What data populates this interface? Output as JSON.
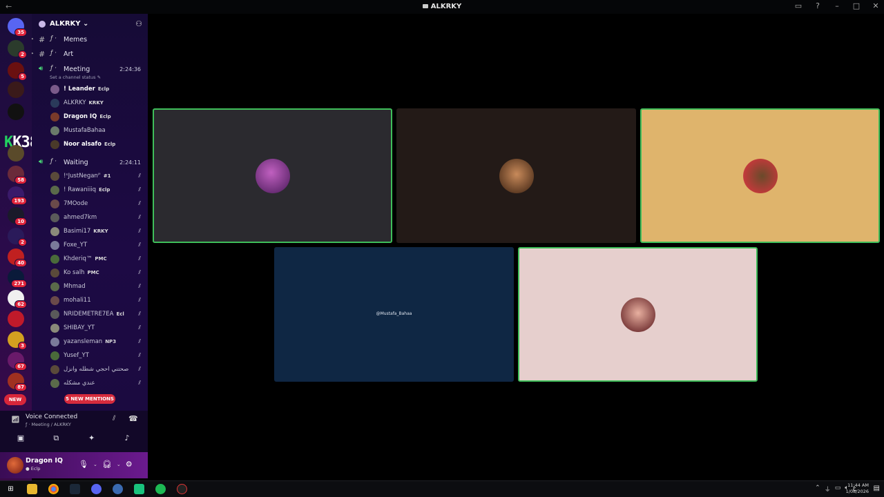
{
  "window": {
    "title": "ALKRKY"
  },
  "server_badges": [
    "35",
    "2",
    "5",
    "58",
    "193",
    "10",
    "2",
    "40",
    "271",
    "62",
    "3",
    "67",
    "87",
    "2"
  ],
  "server_new_label": "NEW",
  "promo_text": "K38",
  "guild": {
    "name": "ALKRKY"
  },
  "channels": {
    "memes": "Memes",
    "art": "Art",
    "meeting": {
      "name": "Meeting",
      "time": "2:24:36",
      "status": "Set a channel status"
    },
    "waiting": {
      "name": "Waiting",
      "time": "2:24:11"
    }
  },
  "meeting_members": [
    {
      "name": "! Leander",
      "tag": "Eclp",
      "bold": true
    },
    {
      "name": "ALKRKY",
      "tag": "KRKY",
      "bold": false
    },
    {
      "name": "Dragon IQ",
      "tag": "Eclp",
      "bold": true
    },
    {
      "name": "MustafaBahaa",
      "tag": "",
      "bold": false
    },
    {
      "name": "Noor alsafo",
      "tag": "Eclp",
      "bold": true
    }
  ],
  "waiting_members": [
    {
      "name": "!ˢJustNeganᴵ'",
      "tag": "#1"
    },
    {
      "name": "! Rawaniiiq",
      "tag": "Eclp"
    },
    {
      "name": "7MOode",
      "tag": ""
    },
    {
      "name": "ahmed7km",
      "tag": ""
    },
    {
      "name": "Basimi17",
      "tag": "KRKY"
    },
    {
      "name": "Foxe_YT",
      "tag": ""
    },
    {
      "name": "Khderiq™",
      "tag": "PMC"
    },
    {
      "name": "Ko salh",
      "tag": "PMC"
    },
    {
      "name": "Mhmad",
      "tag": ""
    },
    {
      "name": "mohali11",
      "tag": ""
    },
    {
      "name": "NRIDEMETRE7EA",
      "tag": "Ecl"
    },
    {
      "name": "SHIBAY_YT",
      "tag": ""
    },
    {
      "name": "yazansleman",
      "tag": "NP3"
    },
    {
      "name": "Yusef_YT",
      "tag": ""
    },
    {
      "name": "صحتني احجي شطله وانزل",
      "tag": ""
    },
    {
      "name": "عندي مشكله",
      "tag": ""
    }
  ],
  "mentions_label": "5 NEW MENTIONS",
  "voice_panel": {
    "title": "Voice Connected",
    "location": "Meeting / ALKRKY"
  },
  "user": {
    "name": "Dragon IQ",
    "status": "Eclp"
  },
  "video_tiles": [
    {
      "label": ""
    },
    {
      "label": ""
    },
    {
      "label": ""
    },
    {
      "label": "@Mustafa_Bahaa"
    },
    {
      "label": ""
    }
  ],
  "taskbar": {
    "time": "11:44 AM",
    "date": "1/08/2026",
    "lang": "ع"
  },
  "colors": {
    "speaking": "#3fbf5a",
    "mention": "#d62b3d",
    "accent": "#6b1a8e"
  },
  "icons": [
    "back-icon",
    "forward-icon",
    "inbox-icon",
    "help-icon",
    "minimize-icon",
    "maximize-icon",
    "close-icon",
    "add-user-icon",
    "hash-icon",
    "speaker-icon",
    "mute-icon",
    "deafen-icon",
    "disconnect-icon",
    "signal-icon",
    "camera-icon",
    "screenshare-icon",
    "activity-icon",
    "soundboard-icon",
    "mic-icon",
    "headset-icon",
    "settings-icon",
    "windows-start-icon"
  ]
}
